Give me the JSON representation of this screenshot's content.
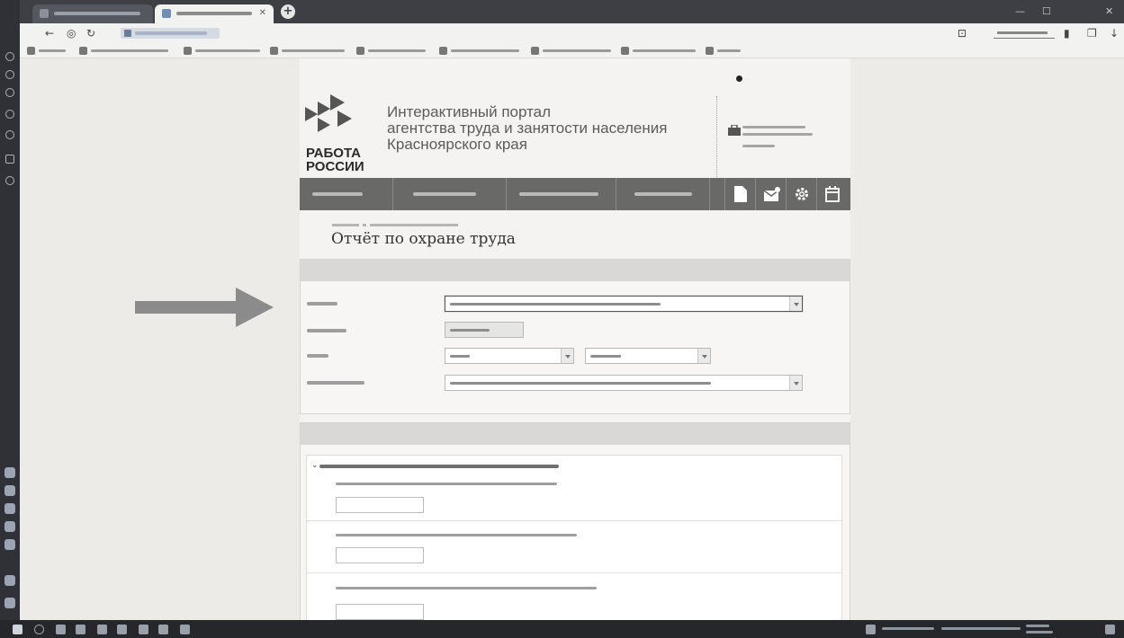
{
  "browser": {
    "tabs": [
      {
        "label": "",
        "active": false,
        "has_close": false
      },
      {
        "label": "",
        "active": true,
        "has_close": true
      }
    ],
    "page_title": "",
    "reviews_label": "",
    "bookmarks": [
      "",
      "",
      "",
      "",
      "",
      "",
      "",
      "",
      ""
    ],
    "icons": [
      "back-arrow-icon",
      "refresh-icon",
      "lock-icon",
      "bookmark-icon",
      "download-icon"
    ]
  },
  "site": {
    "visually_impaired_link": "",
    "logo_text": "РАБОТА РОССИИ",
    "portal_title_line1": "Интерактивный портал",
    "portal_title_line2": "агентства труда и занятости населения",
    "portal_title_line3": "Красноярского края",
    "cabinet_title": "",
    "cabinet_user_lines": [
      "",
      "",
      ""
    ],
    "logout_label": "",
    "nav_items": [
      "",
      "",
      "",
      ""
    ],
    "nav_icons": [
      "document-icon",
      "mail-icon",
      "gear-icon",
      "calendar-icon"
    ],
    "breadcrumb": [
      "",
      ""
    ],
    "report_title": "Отчёт по охране труда"
  },
  "basic_info": {
    "heading": "",
    "fields": [
      {
        "label": "",
        "value": "",
        "type": "select",
        "highlighted": true
      },
      {
        "label": "",
        "value": "",
        "type": "readonly"
      },
      {
        "label": "",
        "value": "",
        "type": "select",
        "second_value": ""
      },
      {
        "label": "",
        "value": "",
        "type": "select"
      }
    ]
  },
  "indicators": {
    "heading": "",
    "section_title": "",
    "questions": [
      "",
      "",
      ""
    ],
    "answers": [
      "",
      "",
      ""
    ]
  },
  "annotation": {
    "arrow_color": "#8b8b8b"
  },
  "colors": {
    "nav_bg": "#696968",
    "panel_head": "#d9d8d6",
    "page_bg": "#ecebe8"
  }
}
